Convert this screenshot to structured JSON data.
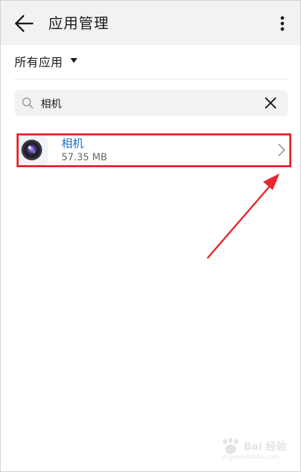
{
  "header": {
    "title": "应用管理",
    "back_icon": "arrow-left-icon",
    "more_icon": "more-vertical-icon"
  },
  "filter": {
    "label": "所有应用",
    "icon": "caret-down-icon"
  },
  "search": {
    "value": "相机",
    "icon": "search-icon",
    "clear_icon": "close-icon"
  },
  "apps": [
    {
      "name": "相机",
      "size": "57.35 MB",
      "icon": "camera-app-icon"
    }
  ],
  "annotation": {
    "highlight_color": "#e8262d"
  },
  "watermark": {
    "text": "Bai 经验",
    "sub": "jingyan.baidu.com"
  },
  "colors": {
    "header_bg": "#f2f2f2",
    "app_name": "#1e6fc7",
    "accent_red": "#e8262d"
  }
}
